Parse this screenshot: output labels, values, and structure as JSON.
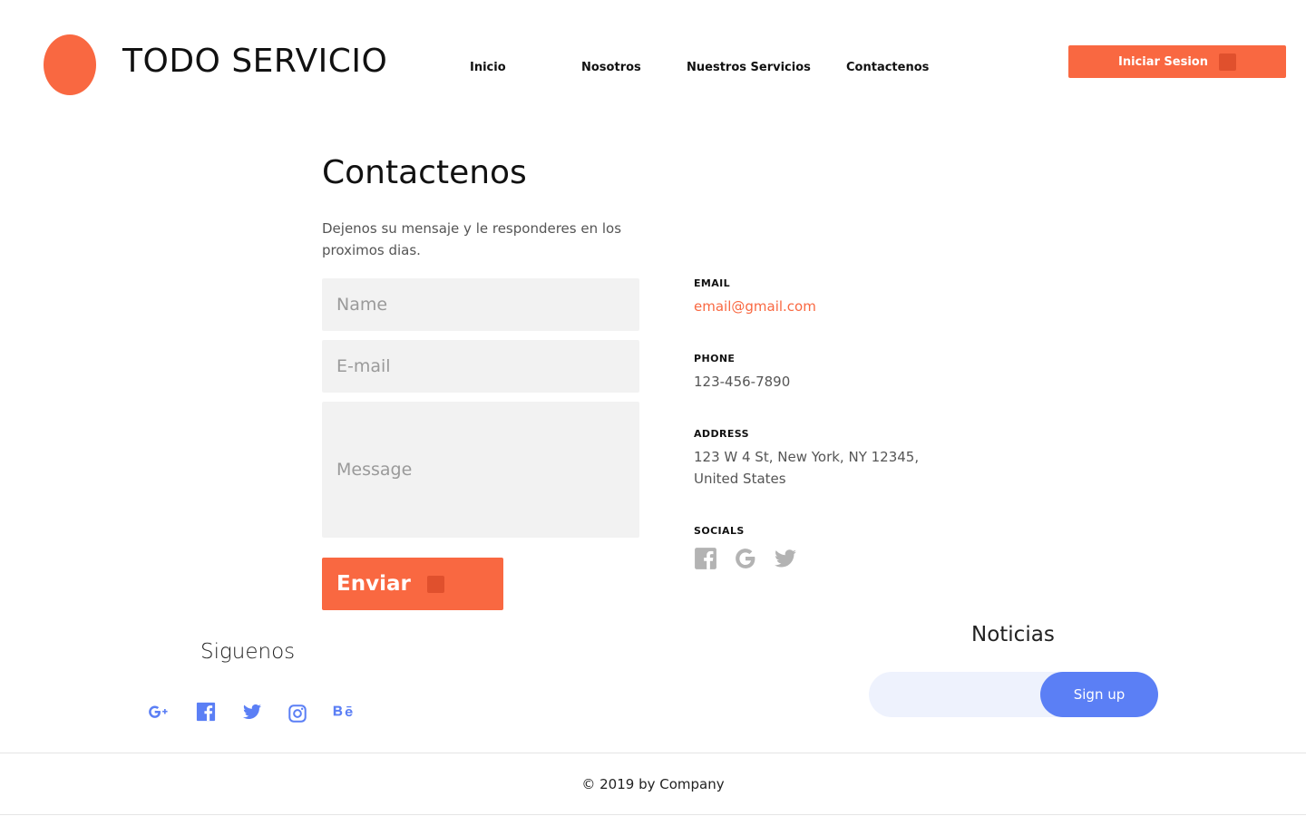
{
  "header": {
    "brand": "TODO SERVICIO",
    "nav": [
      "Inicio",
      "Nosotros",
      "Nuestros Servicios",
      "Contactenos"
    ],
    "login_label": "Iniciar Sesion"
  },
  "contact": {
    "title": "Contactenos",
    "subtitle": "Dejenos su mensaje y le responderes en los proximos dias.",
    "form": {
      "name_placeholder": "Name",
      "email_placeholder": "E-mail",
      "message_placeholder": "Message",
      "submit_label": "Enviar"
    },
    "info": {
      "email_label": "EMAIL",
      "email_value": "email@gmail.com",
      "phone_label": "PHONE",
      "phone_value": "123-456-7890",
      "address_label": "ADDRESS",
      "address_line1": "123 W 4 St, New York, NY 12345,",
      "address_line2": "United States",
      "socials_label": "SOCIALS",
      "socials": [
        "facebook-icon",
        "google-icon",
        "twitter-icon"
      ]
    }
  },
  "follow": {
    "title": "Siguenos",
    "icons": [
      "google-plus-icon",
      "facebook-icon",
      "twitter-icon",
      "instagram-icon",
      "behance-icon"
    ]
  },
  "newsletter": {
    "title": "Noticias",
    "input_placeholder": "",
    "button_label": "Sign up"
  },
  "footer": {
    "copyright": "© 2019 by Company"
  },
  "colors": {
    "accent": "#f96841",
    "accent_dark": "#e0502d",
    "blue": "#5b7ff5",
    "field_bg": "#f2f2f2",
    "icon_gray": "#b3b3b3"
  }
}
